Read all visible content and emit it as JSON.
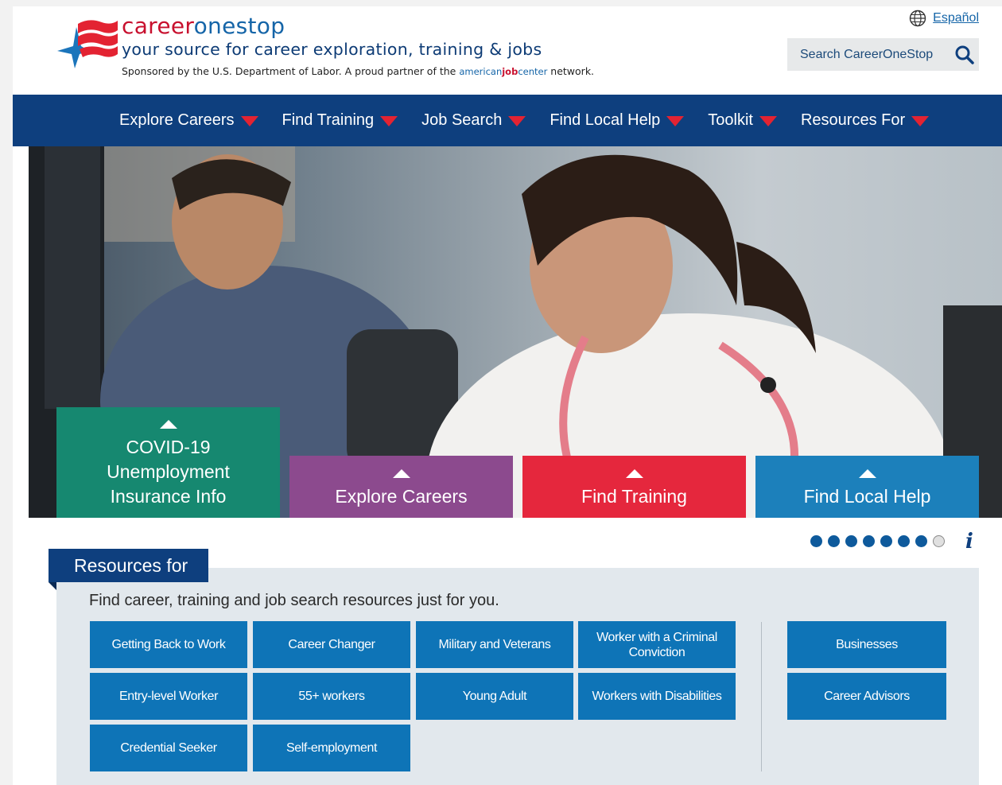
{
  "header": {
    "brand_part1": "career",
    "brand_part2": "onestop",
    "tagline": "your source for career exploration, training & jobs",
    "sponsor_prefix": "Sponsored by the U.S. Department of Labor. A proud partner of the",
    "ajc_part1": "american",
    "ajc_part2": "job",
    "ajc_part3": "center",
    "sponsor_suffix": "network.",
    "language_link": "Español",
    "search_placeholder": "Search CareerOneStop"
  },
  "nav": {
    "items": [
      {
        "label": "Explore Careers"
      },
      {
        "label": "Find Training"
      },
      {
        "label": "Job Search"
      },
      {
        "label": "Find Local Help"
      },
      {
        "label": "Toolkit"
      },
      {
        "label": "Resources For"
      }
    ]
  },
  "hero": {
    "tiles": [
      {
        "label": "COVID-19 Unemployment Insurance Info",
        "color": "#168870"
      },
      {
        "label": "Explore Careers",
        "color": "#8c4a8e"
      },
      {
        "label": "Find Training",
        "color": "#e5273d"
      },
      {
        "label": "Find Local Help",
        "color": "#1c80bb"
      }
    ],
    "carousel": {
      "total": 8,
      "active": [
        1,
        2,
        3,
        4,
        5,
        6,
        7
      ],
      "info_label": "i"
    }
  },
  "resources": {
    "tab_title": "Resources for",
    "intro": "Find career, training and job search resources just for you.",
    "buttons": [
      "Getting Back to Work",
      "Career Changer",
      "Military and Veterans",
      "Worker with a Criminal Conviction",
      "Entry-level Worker",
      "55+ workers",
      "Young Adult",
      "Workers with Disabilities",
      "Credential Seeker",
      "Self-employment"
    ],
    "side_buttons": [
      "Businesses",
      "Career Advisors"
    ]
  },
  "colors": {
    "nav_bg": "#0e3f7e",
    "accent_red": "#e32332",
    "button_blue": "#0e74b7",
    "resources_bg": "#e2e8ed"
  }
}
